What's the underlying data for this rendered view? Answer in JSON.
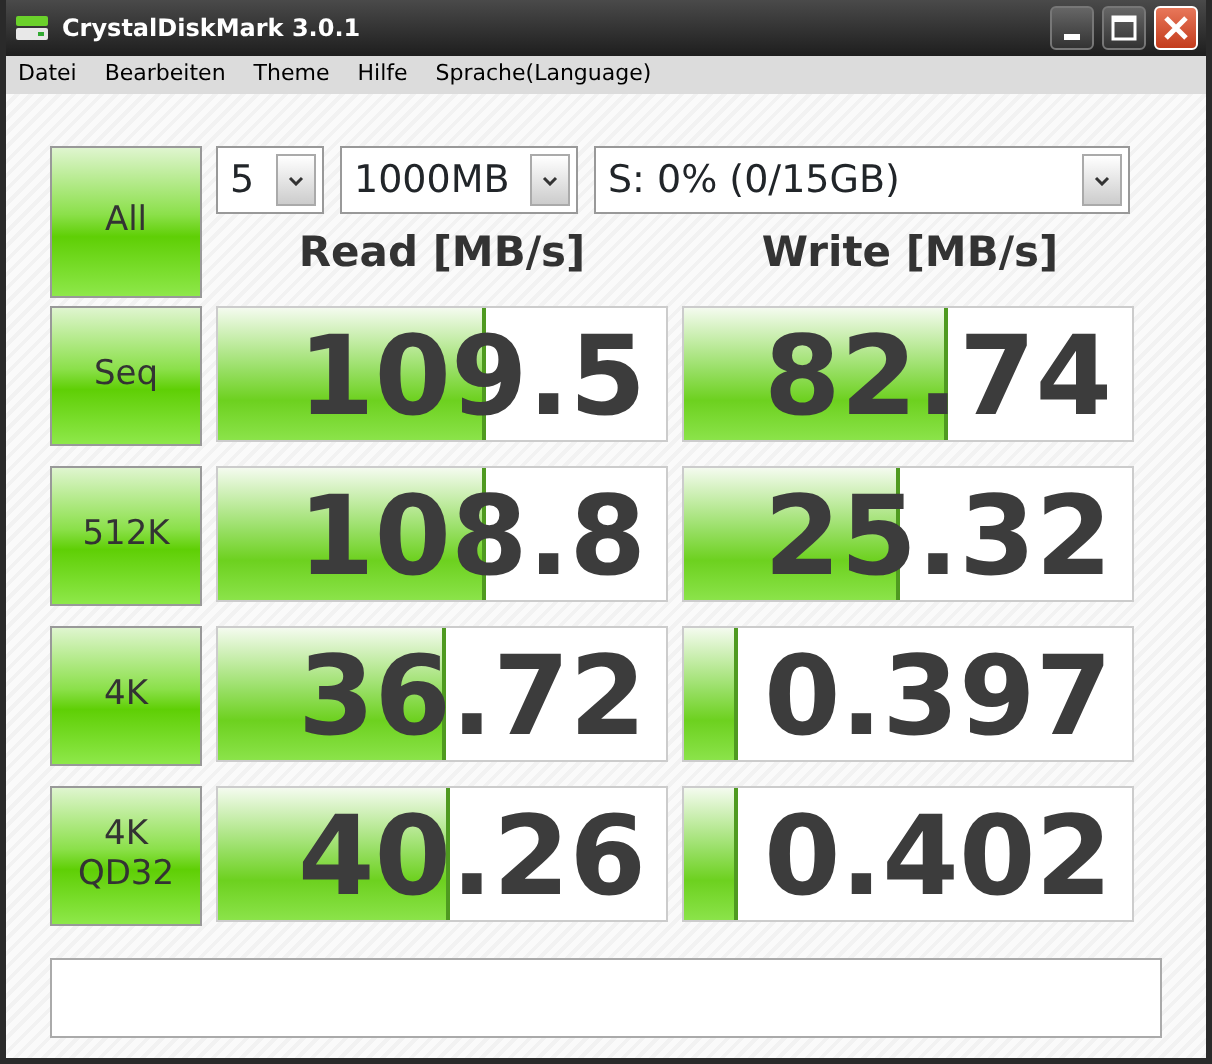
{
  "window": {
    "title": "CrystalDiskMark 3.0.1"
  },
  "menu": [
    {
      "label": "Datei"
    },
    {
      "label": "Bearbeiten"
    },
    {
      "label": "Theme"
    },
    {
      "label": "Hilfe"
    },
    {
      "label": "Sprache(Language)"
    }
  ],
  "all_button": "All",
  "test_count": {
    "value": "5"
  },
  "test_size": {
    "value": "1000MB"
  },
  "drive": {
    "value": "S: 0% (0/15GB)"
  },
  "columns": [
    "Read [MB/s]",
    "Write [MB/s]"
  ],
  "tests": [
    {
      "label": "Seq",
      "read": {
        "value": "109.5",
        "level": 0.6
      },
      "write": {
        "value": "82.74",
        "level": 0.59
      }
    },
    {
      "label": "512K",
      "read": {
        "value": "108.8",
        "level": 0.6
      },
      "write": {
        "value": "25.32",
        "level": 0.48
      }
    },
    {
      "label": "4K",
      "read": {
        "value": "36.72",
        "level": 0.51
      },
      "write": {
        "value": "0.397",
        "level": 0.12
      }
    },
    {
      "label": "4K\nQD32",
      "read": {
        "value": "40.26",
        "level": 0.52
      },
      "write": {
        "value": "0.402",
        "level": 0.12
      }
    }
  ]
}
